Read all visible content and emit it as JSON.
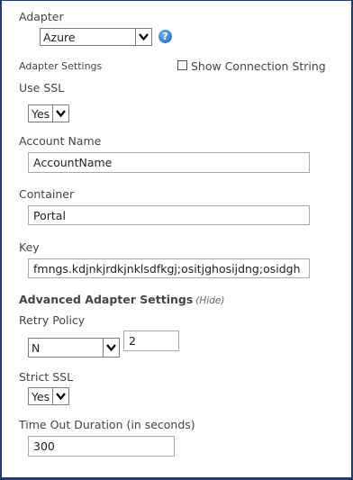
{
  "adapter": {
    "label": "Adapter",
    "selected": "Azure",
    "help_glyph": "?"
  },
  "adapter_settings": {
    "label": "Adapter Settings",
    "show_connection_string": {
      "label": "Show Connection String",
      "checked": false
    }
  },
  "use_ssl": {
    "label": "Use SSL",
    "selected": "Yes"
  },
  "account_name": {
    "label": "Account Name",
    "value": "AccountName"
  },
  "container": {
    "label": "Container",
    "value": "Portal"
  },
  "key": {
    "label": "Key",
    "value": "fmngs.kdjnkjrdkjnklsdfkgj;ositjghosijdng;osidgh"
  },
  "advanced": {
    "heading": "Advanced Adapter Settings",
    "hide_link": "(Hide)",
    "retry_policy": {
      "label": "Retry Policy",
      "selected": "N",
      "count": "2"
    },
    "strict_ssl": {
      "label": "Strict SSL",
      "selected": "Yes"
    },
    "timeout": {
      "label": "Time Out Duration (in seconds)",
      "value": "300"
    }
  }
}
